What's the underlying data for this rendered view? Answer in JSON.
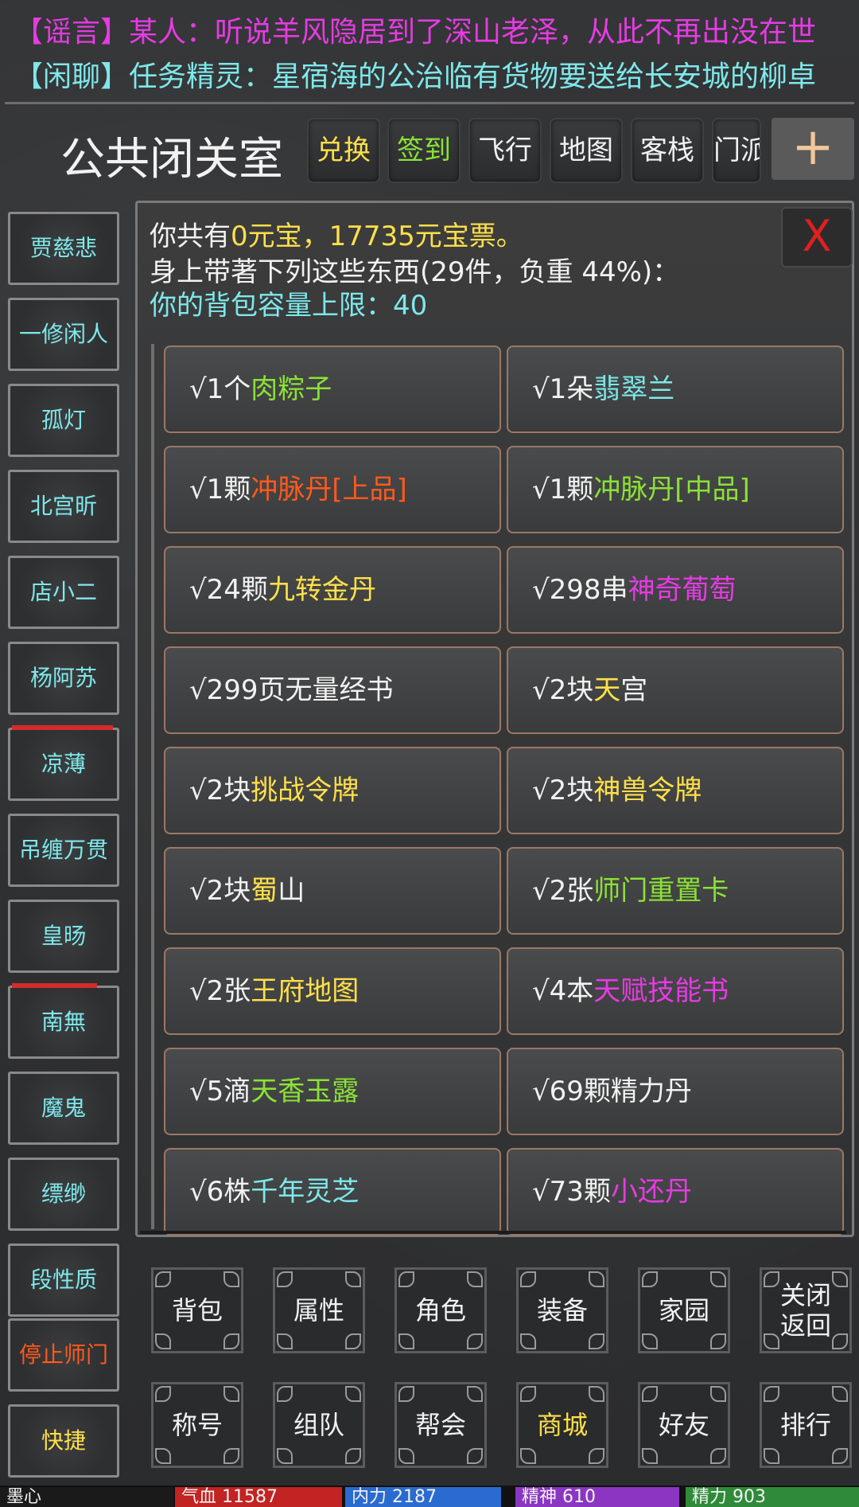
{
  "news": {
    "line1": "【谣言】某人：听说羊风隐居到了深山老泽，从此不再出没在世",
    "line2": "【闲聊】任务精灵：星宿海的公治临有货物要送给长安城的柳卓"
  },
  "header": {
    "title": "公共闭关室",
    "tabs": [
      {
        "label": "兑换",
        "color": "#ffe04a"
      },
      {
        "label": "签到",
        "color": "#8be236"
      },
      {
        "label": "飞行",
        "color": "#f2f2f2"
      },
      {
        "label": "地图",
        "color": "#f2f2f2"
      },
      {
        "label": "客栈",
        "color": "#f2f2f2"
      },
      {
        "label": "门派",
        "color": "#f2f2f2"
      }
    ],
    "plus": "+"
  },
  "sidebar": {
    "items": [
      {
        "label": "贾慈悲"
      },
      {
        "label": "一修闲人"
      },
      {
        "label": "孤灯"
      },
      {
        "label": "北宫昕"
      },
      {
        "label": "店小二"
      },
      {
        "label": "杨阿苏"
      },
      {
        "label": "凉薄",
        "hp": 0.98
      },
      {
        "label": "吊缠万贯"
      },
      {
        "label": "皇旸"
      },
      {
        "label": "南無",
        "hp": 0.82
      },
      {
        "label": "魔鬼"
      },
      {
        "label": "缥缈"
      },
      {
        "label": "段性质"
      },
      {
        "label": "停止师门"
      },
      {
        "label": "快捷"
      }
    ]
  },
  "inventory": {
    "line1_prefix": "你共有",
    "line1_value": "0元宝，17735元宝票。",
    "line2": "身上带著下列这些东西(29件，负重  44%)：",
    "line3": "你的背包容量上限：40",
    "close": "X",
    "items": [
      {
        "prefix": "√1个",
        "name": "肉粽子",
        "color": "#8be236"
      },
      {
        "prefix": "√1朵",
        "name": "翡翠兰",
        "color": "#7ee8ea"
      },
      {
        "prefix": "√1颗",
        "name": "冲脉丹[上品]",
        "color": "#ff5a1c"
      },
      {
        "prefix": "√1颗",
        "name": "冲脉丹[中品]",
        "color": "#8be236"
      },
      {
        "prefix": "√24颗",
        "name": "九转金丹",
        "color": "#ffe04a"
      },
      {
        "prefix": "√298串",
        "name": "神奇葡萄",
        "color": "#e63be3"
      },
      {
        "prefix": "√299页无量经书",
        "name": "",
        "color": "#f2f2f2"
      },
      {
        "prefix": "√2块",
        "name": "天",
        "suffix": "宫",
        "color": "#ffe04a"
      },
      {
        "prefix": "√2块",
        "name": "挑战令牌",
        "color": "#ffe04a"
      },
      {
        "prefix": "√2块",
        "name": "神兽令牌",
        "color": "#ffe04a"
      },
      {
        "prefix": "√2块",
        "name": "蜀",
        "suffix": "山",
        "color": "#ffe04a"
      },
      {
        "prefix": "√2张",
        "name": "师门重置卡",
        "color": "#8be236"
      },
      {
        "prefix": "√2张",
        "name": "王府地图",
        "color": "#ffe04a"
      },
      {
        "prefix": "√4本",
        "name": "天赋技能书",
        "color": "#e63be3"
      },
      {
        "prefix": "√5滴",
        "name": "天香玉露",
        "color": "#8be236"
      },
      {
        "prefix": "√69颗精力丹",
        "name": "",
        "color": "#f2f2f2"
      },
      {
        "prefix": "√6株",
        "name": "千年灵芝",
        "color": "#7ee8ea"
      },
      {
        "prefix": "√73颗",
        "name": "小还丹",
        "color": "#e63be3"
      }
    ]
  },
  "bottom_menu": {
    "row1": [
      "背包",
      "属性",
      "角色",
      "装备",
      "家园",
      "关闭\n返回"
    ],
    "row2": [
      "称号",
      "组队",
      "帮会",
      "商城",
      "好友",
      "排行"
    ]
  },
  "status": {
    "name": "墨心",
    "hp": "气血 11587",
    "mp": "内力 2187",
    "spirit": "精神 610",
    "energy": "精力 903"
  }
}
